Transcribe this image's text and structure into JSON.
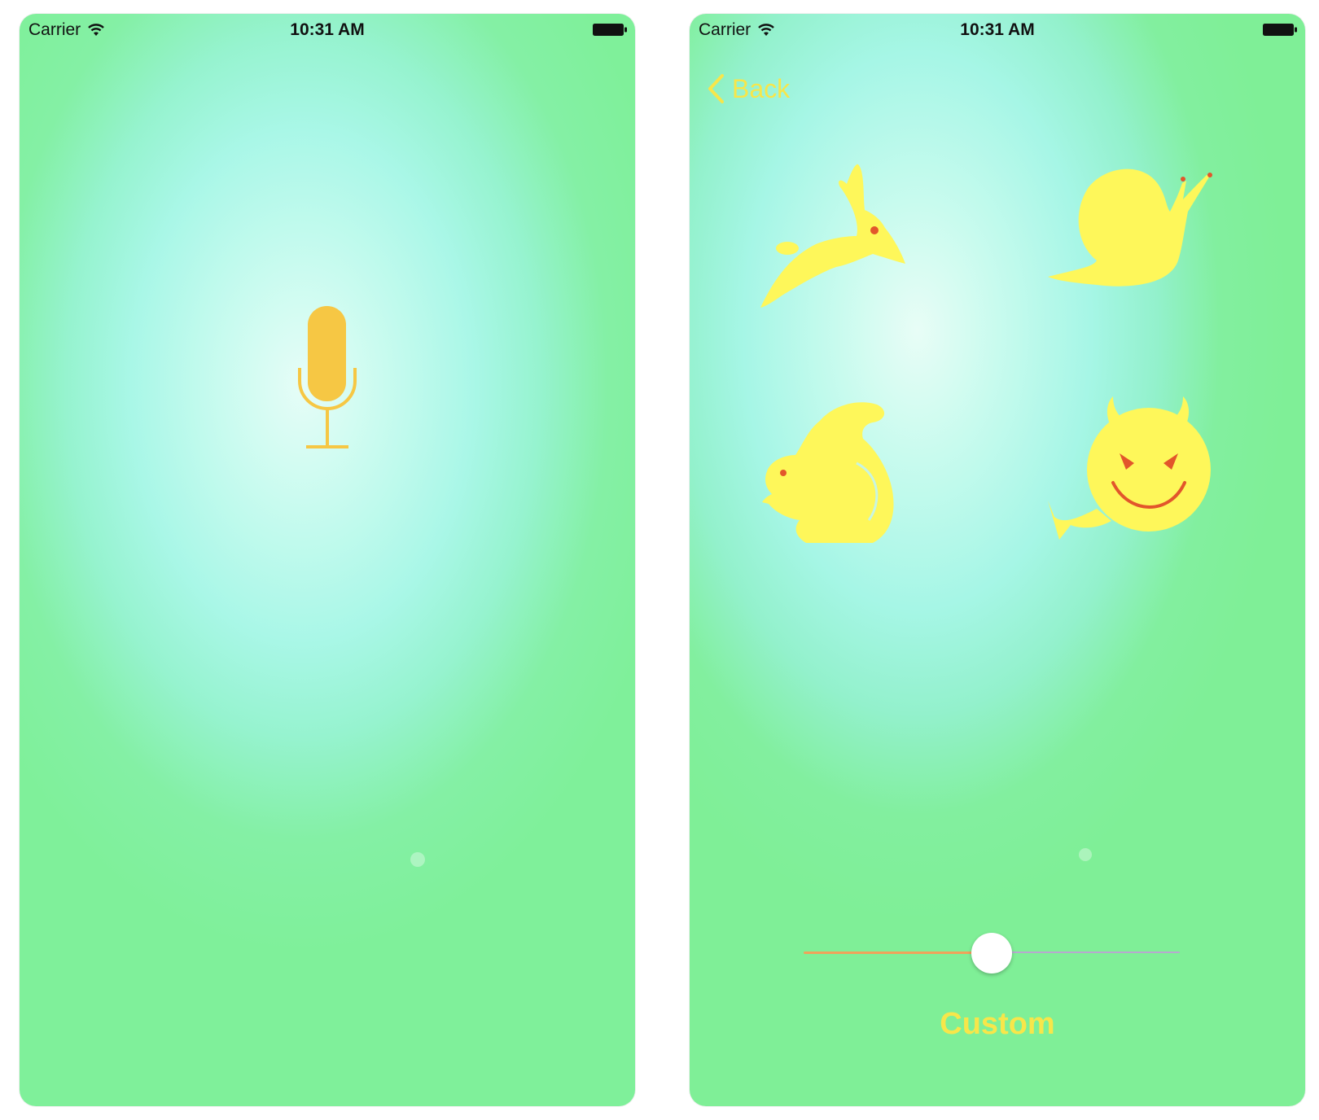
{
  "screens": [
    {
      "status_bar": {
        "carrier": "Carrier",
        "time": "10:31 AM"
      },
      "record_button": {
        "icon": "microphone-icon",
        "color": "#f6c744"
      }
    },
    {
      "status_bar": {
        "carrier": "Carrier",
        "time": "10:31 AM"
      },
      "nav": {
        "back_label": "Back"
      },
      "effects": [
        {
          "icon": "rabbit-icon"
        },
        {
          "icon": "snail-icon"
        },
        {
          "icon": "squirrel-icon"
        },
        {
          "icon": "devil-icon"
        }
      ],
      "slider": {
        "value": 0.5
      },
      "mode_label": "Custom",
      "accent_color": "#fef75a",
      "eye_color": "#e2562b"
    }
  ]
}
